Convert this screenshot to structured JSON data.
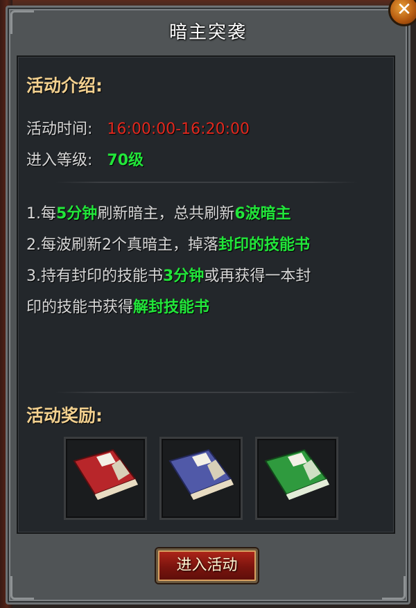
{
  "dialog": {
    "title": "暗主突袭",
    "close_icon": "close-icon"
  },
  "intro": {
    "heading": "活动介绍:",
    "time_label": "活动时间:",
    "time_value": "16:00:00-16:20:00",
    "level_label": "进入等级:",
    "level_value": "70级"
  },
  "rules": [
    {
      "parts": [
        {
          "t": "1.每",
          "c": "normal"
        },
        {
          "t": "5分钟",
          "c": "green"
        },
        {
          "t": "刷新暗主，总共刷新",
          "c": "normal"
        },
        {
          "t": "6波暗主",
          "c": "green"
        }
      ]
    },
    {
      "parts": [
        {
          "t": "2.每波刷新2个真暗主，掉落",
          "c": "normal"
        },
        {
          "t": "封印的技能书",
          "c": "green"
        }
      ]
    },
    {
      "parts": [
        {
          "t": "3.持有封印的技能书",
          "c": "normal"
        },
        {
          "t": "3分钟",
          "c": "green"
        },
        {
          "t": "或再获得一本封",
          "c": "normal"
        }
      ]
    },
    {
      "parts": [
        {
          "t": "印的技能书获得",
          "c": "normal"
        },
        {
          "t": "解封技能书",
          "c": "green"
        }
      ]
    }
  ],
  "rewards": {
    "heading": "活动奖励:",
    "items": [
      {
        "icon": "red-skill-book-icon",
        "color": "#b8262a"
      },
      {
        "icon": "blue-skill-book-icon",
        "color": "#5059a8"
      },
      {
        "icon": "green-skill-book-icon",
        "color": "#2f9a3e"
      }
    ]
  },
  "enter_button": {
    "label": "进入活动"
  },
  "colors": {
    "accent_gold": "#f2d08f",
    "time_red": "#e0281e",
    "highlight_green": "#22e63a"
  }
}
